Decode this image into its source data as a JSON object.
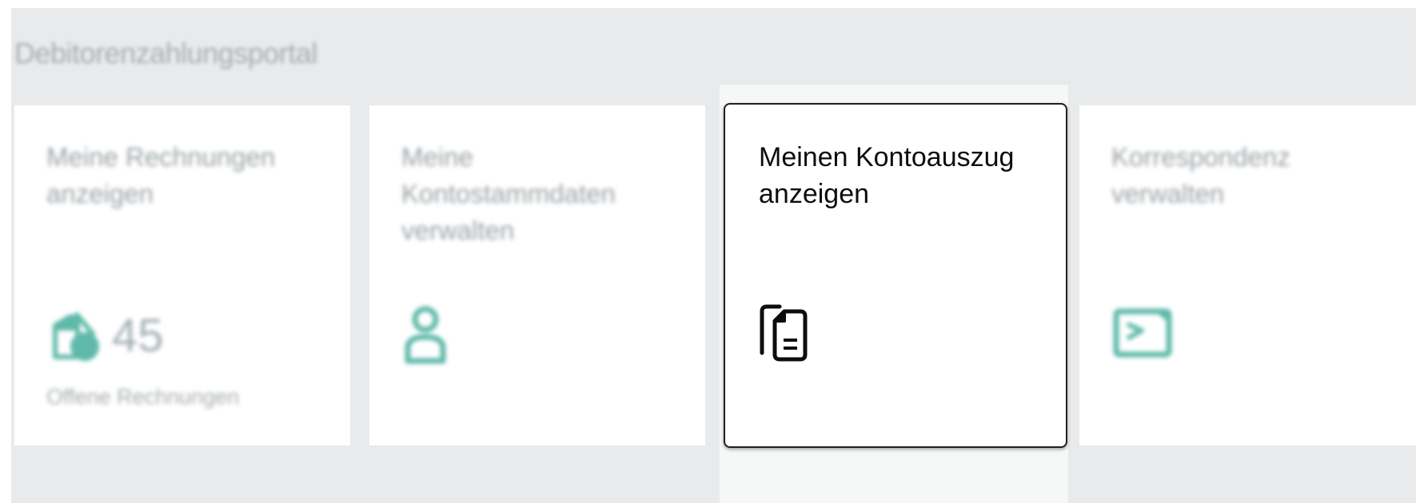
{
  "portal": {
    "title": "Debitorenzahlungsportal"
  },
  "tiles": [
    {
      "title": "Meine Rechnungen anzeigen",
      "kpi_value": "45",
      "kpi_label": "Offene Rechnungen",
      "icon": "invoice-icon"
    },
    {
      "title": "Meine Kontostammdaten verwalten",
      "icon": "person-icon"
    },
    {
      "title": "Meinen Kontoauszug anzeigen",
      "icon": "documents-icon"
    },
    {
      "title": "Korrespondenz verwalten",
      "icon": "correspondence-icon"
    }
  ],
  "colors": {
    "accent": "#5fb9aa",
    "panel_background": "#e8eaeb",
    "tile_background": "#ffffff",
    "focus_border": "#202020"
  }
}
